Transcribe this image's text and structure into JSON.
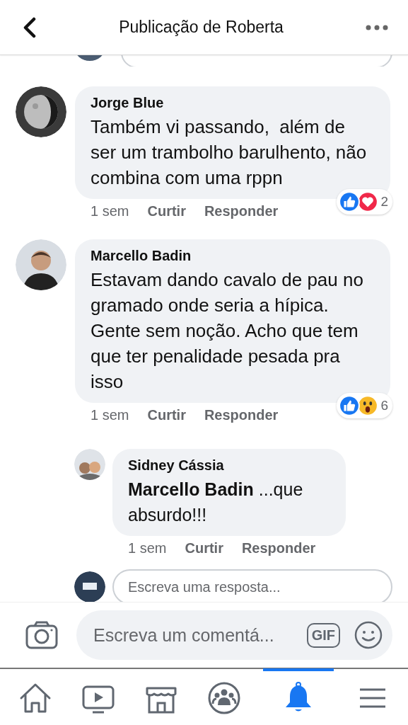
{
  "header": {
    "title": "Publicação de Roberta"
  },
  "comments": [
    {
      "author": "Jorge Blue",
      "text": "Também vi passando,  além de ser um trambolho barulhento, não combina com uma rppn",
      "time": "1 sem",
      "like": "Curtir",
      "reply": "Responder",
      "reactions": [
        {
          "kind": "like"
        },
        {
          "kind": "love"
        }
      ],
      "reaction_count": "2",
      "avatar": {
        "kind": "moon"
      }
    },
    {
      "author": "Marcello Badin",
      "text": "Estavam dando cavalo de pau no gramado onde seria a hípica. Gente sem noção. Acho que tem que ter penalidade pesada pra isso",
      "time": "1 sem",
      "like": "Curtir",
      "reply": "Responder",
      "reactions": [
        {
          "kind": "like"
        },
        {
          "kind": "wow"
        }
      ],
      "reaction_count": "6",
      "avatar": {
        "kind": "person"
      }
    }
  ],
  "reply": {
    "author": "Sidney Cássia",
    "text": "**Marcello Badin** ...que absurdo!!!",
    "time": "1 sem",
    "like": "Curtir",
    "reply": "Responder"
  },
  "reply_field": {
    "placeholder": "Escreva uma resposta..."
  },
  "composer": {
    "placeholder": "Escreva um comentá...",
    "gif": "GIF"
  },
  "tabs": [
    {
      "kind": "home",
      "selected": false
    },
    {
      "kind": "video",
      "selected": false
    },
    {
      "kind": "store",
      "selected": false
    },
    {
      "kind": "groups",
      "selected": false
    },
    {
      "kind": "bell",
      "selected": true
    },
    {
      "kind": "menu",
      "selected": false
    }
  ]
}
